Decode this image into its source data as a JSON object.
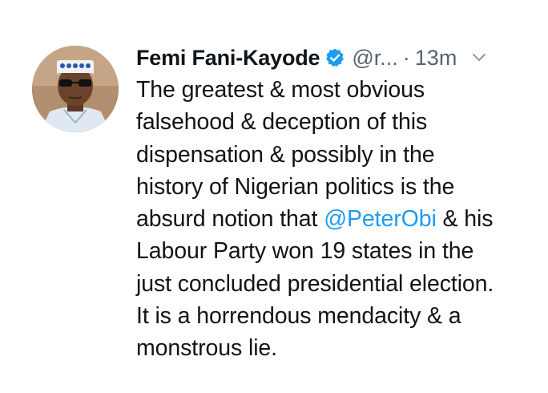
{
  "tweet": {
    "author_name": "Femi Fani-Kayode",
    "handle": "@r...",
    "separator": "·",
    "time": "13m",
    "verified_color": "#1d9bf0",
    "mention_color": "#1d9bf0",
    "icons": {
      "verified": "verified-badge-icon",
      "more": "chevron-down-icon",
      "avatar": "profile-photo"
    },
    "lines": [
      "The greatest & most obvious",
      "falsehood & deception of this",
      "dispensation & possibly in the",
      "history of Nigerian politics is the"
    ],
    "line5_pre": "absurd notion that ",
    "line5_mention": "@PeterObi",
    "line5_post": " & his",
    "lines_after": [
      "Labour Party won 19 states in the",
      "just concluded presidential election.",
      "It is a horrendous mendacity & a",
      "monstrous lie."
    ]
  }
}
